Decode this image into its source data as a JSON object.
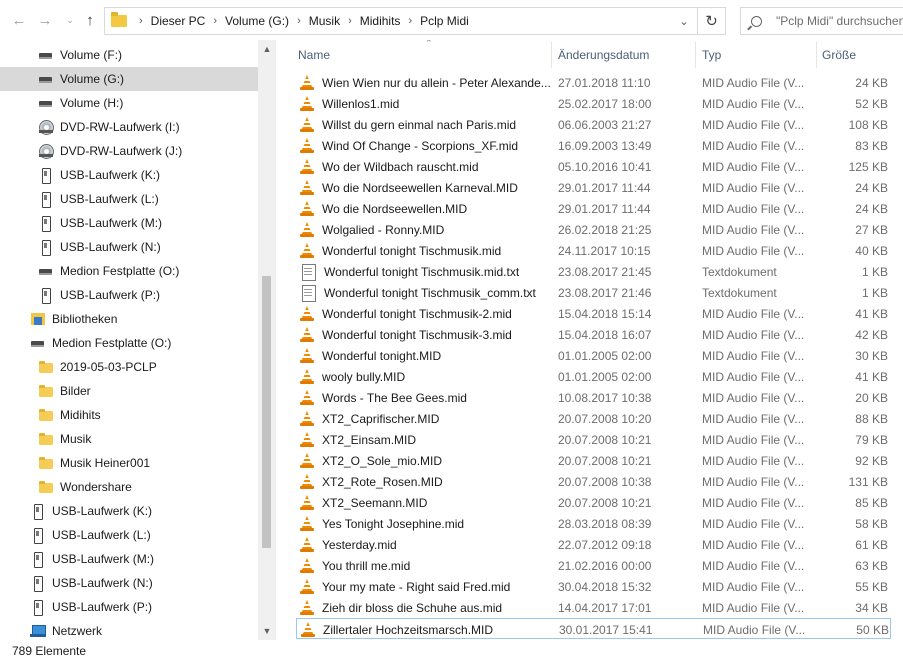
{
  "address": {
    "crumbs": [
      "Dieser PC",
      "Volume (G:)",
      "Musik",
      "Midihits",
      "Pclp Midi"
    ]
  },
  "search": {
    "placeholder": "\"Pclp Midi\" durchsuchen"
  },
  "sidebar": {
    "items": [
      {
        "label": "Volume (F:)",
        "icon": "drive-icon",
        "selected": false
      },
      {
        "label": "Volume (G:)",
        "icon": "drive-icon",
        "selected": true
      },
      {
        "label": "Volume (H:)",
        "icon": "drive-icon",
        "selected": false
      },
      {
        "label": "DVD-RW-Laufwerk (I:)",
        "icon": "dvd-icon",
        "selected": false
      },
      {
        "label": "DVD-RW-Laufwerk (J:)",
        "icon": "dvd-icon",
        "selected": false
      },
      {
        "label": "USB-Laufwerk (K:)",
        "icon": "usb-icon",
        "selected": false
      },
      {
        "label": "USB-Laufwerk (L:)",
        "icon": "usb-icon",
        "selected": false
      },
      {
        "label": "USB-Laufwerk (M:)",
        "icon": "usb-icon",
        "selected": false
      },
      {
        "label": "USB-Laufwerk (N:)",
        "icon": "usb-icon",
        "selected": false
      },
      {
        "label": "Medion Festplatte (O:)",
        "icon": "drive-icon",
        "selected": false
      },
      {
        "label": "USB-Laufwerk (P:)",
        "icon": "usb-icon",
        "selected": false
      },
      {
        "label": "Bibliotheken",
        "icon": "library-icon",
        "selected": false
      },
      {
        "label": "Medion Festplatte (O:)",
        "icon": "drive-icon",
        "selected": false
      },
      {
        "label": "2019-05-03-PCLP",
        "icon": "folder-icon",
        "selected": false
      },
      {
        "label": "Bilder",
        "icon": "folder-icon",
        "selected": false
      },
      {
        "label": "Midihits",
        "icon": "folder-icon",
        "selected": false
      },
      {
        "label": "Musik",
        "icon": "folder-icon",
        "selected": false
      },
      {
        "label": "Musik Heiner001",
        "icon": "folder-icon",
        "selected": false
      },
      {
        "label": "Wondershare",
        "icon": "folder-icon",
        "selected": false
      },
      {
        "label": "USB-Laufwerk (K:)",
        "icon": "usb-icon",
        "selected": false
      },
      {
        "label": "USB-Laufwerk (L:)",
        "icon": "usb-icon",
        "selected": false
      },
      {
        "label": "USB-Laufwerk (M:)",
        "icon": "usb-icon",
        "selected": false
      },
      {
        "label": "USB-Laufwerk (N:)",
        "icon": "usb-icon",
        "selected": false
      },
      {
        "label": "USB-Laufwerk (P:)",
        "icon": "usb-icon",
        "selected": false
      },
      {
        "label": "Netzwerk",
        "icon": "network-icon",
        "selected": false
      }
    ]
  },
  "columns": {
    "name": "Name",
    "date": "Änderungsdatum",
    "type": "Typ",
    "size": "Größe"
  },
  "files": [
    {
      "name": "Wien Wien nur du allein - Peter Alexande...",
      "date": "27.01.2018 11:10",
      "type": "MID Audio File (V...",
      "size": "24 KB",
      "icon": "vlc-icon"
    },
    {
      "name": "Willenlos1.mid",
      "date": "25.02.2017 18:00",
      "type": "MID Audio File (V...",
      "size": "52 KB",
      "icon": "vlc-icon"
    },
    {
      "name": "Willst du gern einmal nach Paris.mid",
      "date": "06.06.2003 21:27",
      "type": "MID Audio File (V...",
      "size": "108 KB",
      "icon": "vlc-icon"
    },
    {
      "name": "Wind Of Change - Scorpions_XF.mid",
      "date": "16.09.2003 13:49",
      "type": "MID Audio File (V...",
      "size": "83 KB",
      "icon": "vlc-icon"
    },
    {
      "name": "Wo der Wildbach rauscht.mid",
      "date": "05.10.2016 10:41",
      "type": "MID Audio File (V...",
      "size": "125 KB",
      "icon": "vlc-icon"
    },
    {
      "name": "Wo die Nordseewellen Karneval.MID",
      "date": "29.01.2017 11:44",
      "type": "MID Audio File (V...",
      "size": "24 KB",
      "icon": "vlc-icon"
    },
    {
      "name": "Wo die Nordseewellen.MID",
      "date": "29.01.2017 11:44",
      "type": "MID Audio File (V...",
      "size": "24 KB",
      "icon": "vlc-icon"
    },
    {
      "name": "Wolgalied - Ronny.MID",
      "date": "26.02.2018 21:25",
      "type": "MID Audio File (V...",
      "size": "27 KB",
      "icon": "vlc-icon"
    },
    {
      "name": "Wonderful tonight Tischmusik.mid",
      "date": "24.11.2017 10:15",
      "type": "MID Audio File (V...",
      "size": "40 KB",
      "icon": "vlc-icon"
    },
    {
      "name": "Wonderful tonight Tischmusik.mid.txt",
      "date": "23.08.2017 21:45",
      "type": "Textdokument",
      "size": "1 KB",
      "icon": "text-file-icon"
    },
    {
      "name": "Wonderful tonight Tischmusik_comm.txt",
      "date": "23.08.2017 21:46",
      "type": "Textdokument",
      "size": "1 KB",
      "icon": "text-file-icon"
    },
    {
      "name": "Wonderful tonight Tischmusik-2.mid",
      "date": "15.04.2018 15:14",
      "type": "MID Audio File (V...",
      "size": "41 KB",
      "icon": "vlc-icon"
    },
    {
      "name": "Wonderful tonight Tischmusik-3.mid",
      "date": "15.04.2018 16:07",
      "type": "MID Audio File (V...",
      "size": "42 KB",
      "icon": "vlc-icon"
    },
    {
      "name": "Wonderful tonight.MID",
      "date": "01.01.2005 02:00",
      "type": "MID Audio File (V...",
      "size": "30 KB",
      "icon": "vlc-icon"
    },
    {
      "name": "wooly bully.MID",
      "date": "01.01.2005 02:00",
      "type": "MID Audio File (V...",
      "size": "41 KB",
      "icon": "vlc-icon"
    },
    {
      "name": "Words - The Bee Gees.mid",
      "date": "10.08.2017 10:38",
      "type": "MID Audio File (V...",
      "size": "20 KB",
      "icon": "vlc-icon"
    },
    {
      "name": "XT2_Caprifischer.MID",
      "date": "20.07.2008 10:20",
      "type": "MID Audio File (V...",
      "size": "88 KB",
      "icon": "vlc-icon"
    },
    {
      "name": "XT2_Einsam.MID",
      "date": "20.07.2008 10:21",
      "type": "MID Audio File (V...",
      "size": "79 KB",
      "icon": "vlc-icon"
    },
    {
      "name": "XT2_O_Sole_mio.MID",
      "date": "20.07.2008 10:21",
      "type": "MID Audio File (V...",
      "size": "92 KB",
      "icon": "vlc-icon"
    },
    {
      "name": "XT2_Rote_Rosen.MID",
      "date": "20.07.2008 10:38",
      "type": "MID Audio File (V...",
      "size": "131 KB",
      "icon": "vlc-icon"
    },
    {
      "name": "XT2_Seemann.MID",
      "date": "20.07.2008 10:21",
      "type": "MID Audio File (V...",
      "size": "85 KB",
      "icon": "vlc-icon"
    },
    {
      "name": "Yes Tonight Josephine.mid",
      "date": "28.03.2018 08:39",
      "type": "MID Audio File (V...",
      "size": "58 KB",
      "icon": "vlc-icon"
    },
    {
      "name": "Yesterday.mid",
      "date": "22.07.2012 09:18",
      "type": "MID Audio File (V...",
      "size": "61 KB",
      "icon": "vlc-icon"
    },
    {
      "name": "You thrill me.mid",
      "date": "21.02.2016 00:00",
      "type": "MID Audio File (V...",
      "size": "63 KB",
      "icon": "vlc-icon"
    },
    {
      "name": "Your my mate - Right said Fred.mid",
      "date": "30.04.2018 15:32",
      "type": "MID Audio File (V...",
      "size": "55 KB",
      "icon": "vlc-icon"
    },
    {
      "name": "Zieh dir bloss die Schuhe aus.mid",
      "date": "14.04.2017 17:01",
      "type": "MID Audio File (V...",
      "size": "34 KB",
      "icon": "vlc-icon"
    },
    {
      "name": "Zillertaler Hochzeitsmarsch.MID",
      "date": "30.01.2017 15:41",
      "type": "MID Audio File (V...",
      "size": "50 KB",
      "icon": "vlc-icon",
      "focused": true
    }
  ],
  "status": {
    "count_text": "789 Elemente"
  }
}
